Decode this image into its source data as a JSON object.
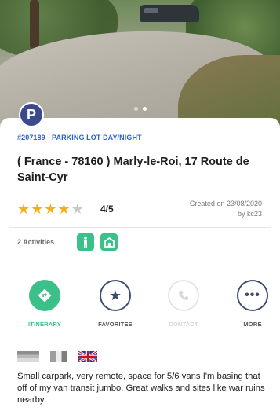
{
  "hero": {
    "slides": 2,
    "active_slide": 1,
    "image_icon": "photo-carpark"
  },
  "badge": {
    "letter": "P",
    "icon": "parking-badge-icon"
  },
  "place": {
    "id_category": "#207189 - PARKING LOT DAY/NIGHT",
    "title": "( France - 78160 ) Marly-le-Roi, 17 Route de Saint-Cyr"
  },
  "rating": {
    "stars_filled": 4,
    "stars_total": 5,
    "score_text": "4/5",
    "created_line1": "Created on 23/08/2020",
    "created_line2": "by kc23"
  },
  "activities": {
    "label": "2 Activities",
    "icons": [
      "hiking-icon",
      "building-icon"
    ]
  },
  "actions": [
    {
      "label": "ITINERARY",
      "icon": "directions-icon"
    },
    {
      "label": "FAVORITES",
      "icon": "star-icon"
    },
    {
      "label": "CONTACT",
      "icon": "phone-icon"
    },
    {
      "label": "MORE",
      "icon": "more-icon"
    }
  ],
  "languages": [
    "grey-flag-icon",
    "grey-flag-icon",
    "uk-flag-icon"
  ],
  "description": "Small carpark, very remote, space for 5/6 vans I'm basing that off of my van transit jumbo. Great walks and sites like war ruins nearby",
  "colors": {
    "accent_green": "#3cc08a",
    "link_blue": "#2a63c7",
    "star_gold": "#f2b11a",
    "badge_navy": "#3b4a8c"
  }
}
